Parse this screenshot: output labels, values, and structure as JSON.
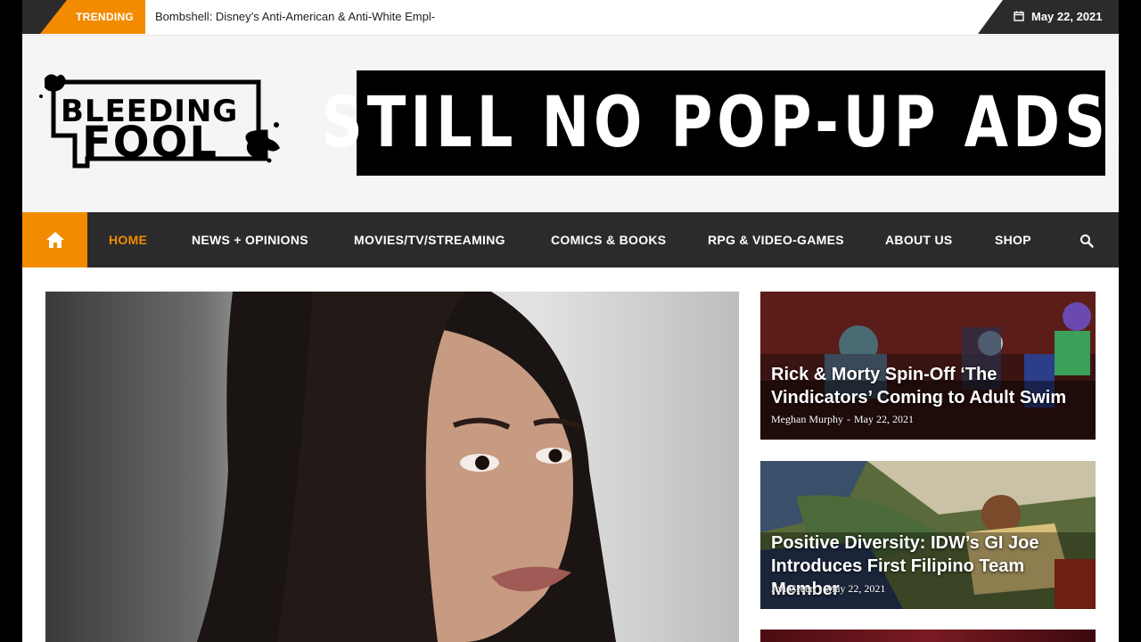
{
  "topbar": {
    "trending_label": "TRENDING",
    "ticker_text": "Bombshell: Disney’s Anti-American & Anti-White Empl-",
    "date": "May 22, 2021"
  },
  "header": {
    "logo_top": "BLEEDING",
    "logo_bottom": "FOOL",
    "banner_text": "STILL NO POP-UP ADS!"
  },
  "nav": {
    "items": [
      {
        "label": "HOME"
      },
      {
        "label": "NEWS + OPINIONS"
      },
      {
        "label": "MOVIES/TV/STREAMING"
      },
      {
        "label": "COMICS & BOOKS"
      },
      {
        "label": "RPG & VIDEO-GAMES"
      },
      {
        "label": "ABOUT US"
      },
      {
        "label": "SHOP"
      }
    ]
  },
  "cards": [
    {
      "title": "Rick & Morty Spin-Off ‘The Vindicators’ Coming to Adult Swim",
      "author": "Meghan Murphy",
      "date": "May 22, 2021"
    },
    {
      "title": "Positive Diversity: IDW’s GI Joe Introduces First Filipino Team Member",
      "author": "Avi Green",
      "date": "May 22, 2021"
    }
  ],
  "colors": {
    "accent": "#f28b00",
    "nav_bg": "#2b2b2b"
  }
}
